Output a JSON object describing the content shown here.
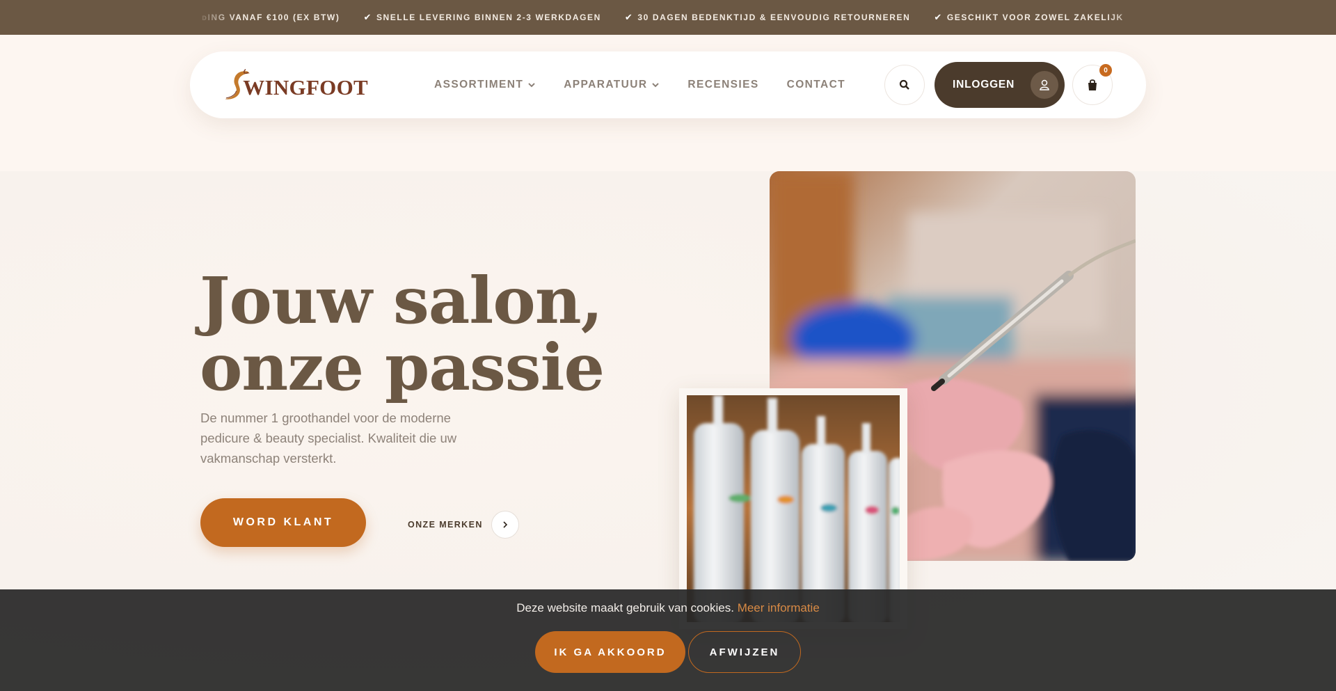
{
  "usp_bar": {
    "items": [
      "ᴅING VANAF €100 (EX BTW)",
      "SNELLE LEVERING BINNEN 2-3 WERKDAGEN",
      "30 DAGEN BEDENKTIJD & EENVOUDIG RETOURNEREN",
      "GESCHIKT VOOR ZOWEL ZAKELIJK"
    ],
    "check_icon": "check-icon"
  },
  "header": {
    "logo_text": "WINGFOOT",
    "nav": [
      {
        "label": "ASSORTIMENT",
        "has_dropdown": true
      },
      {
        "label": "APPARATUUR",
        "has_dropdown": true
      },
      {
        "label": "RECENSIES",
        "has_dropdown": false
      },
      {
        "label": "CONTACT",
        "has_dropdown": false
      }
    ],
    "search_icon": "search-icon",
    "login_label": "INLOGGEN",
    "user_icon": "user-icon",
    "cart_icon": "shopping-bag-icon",
    "cart_count": "0"
  },
  "hero": {
    "title_line1": "Jouw salon,",
    "title_line2": "onze passie",
    "subtitle": "De nummer 1 groothandel voor de moderne pedicure & beauty specialist. Kwaliteit die uw vakmanschap versterkt.",
    "cta_label": "WORD KLANT",
    "brands_label": "ONZE MERKEN"
  },
  "cookie": {
    "text": "Deze website maakt gebruik van cookies.",
    "link_label": "Meer informatie",
    "accept_label": "IK GA AKKOORD",
    "decline_label": "AFWIJZEN"
  },
  "colors": {
    "brand_brown": "#6b5844",
    "dark_brown": "#4b3b2c",
    "accent_orange": "#c2691f",
    "logo_text": "#7a3b24"
  }
}
